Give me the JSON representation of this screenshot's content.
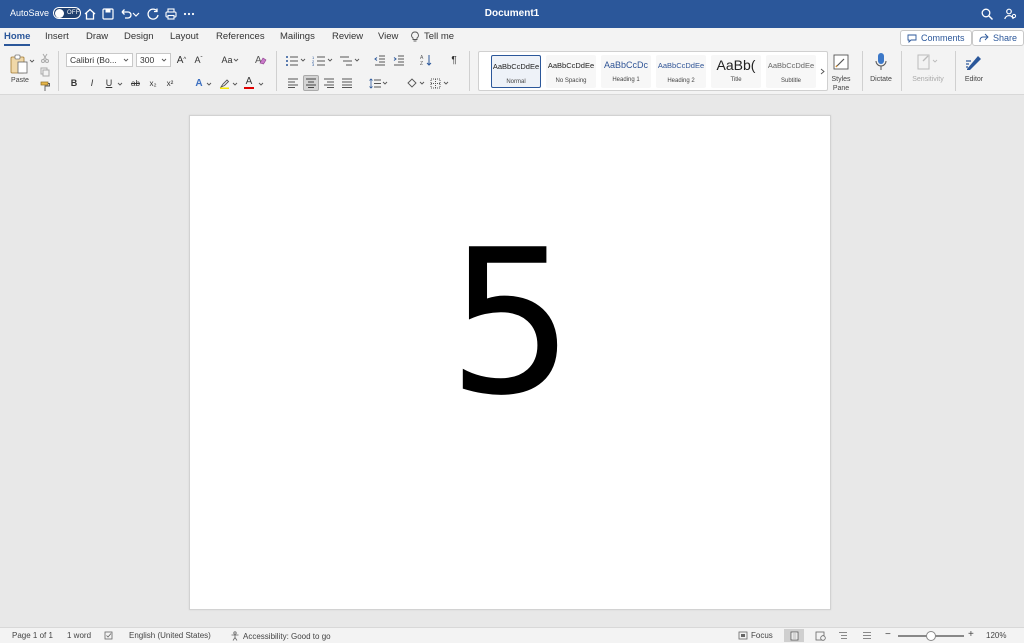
{
  "titlebar": {
    "autosave_label": "AutoSave",
    "autosave_state": "OFF",
    "doc_title": "Document1"
  },
  "tabs": [
    "Home",
    "Insert",
    "Draw",
    "Design",
    "Layout",
    "References",
    "Mailings",
    "Review",
    "View"
  ],
  "tell_me": "Tell me",
  "header_buttons": {
    "comments": "Comments",
    "share": "Share"
  },
  "ribbon": {
    "paste_label": "Paste",
    "font_name": "Calibri (Bo...",
    "font_size": "300",
    "case_label": "Aa",
    "bold": "B",
    "italic": "I",
    "underline": "U",
    "strike": "ab",
    "subscript": "x₂",
    "superscript": "x²",
    "font_color_glyph": "A",
    "text_effects_glyph": "A",
    "pilcrow": "¶",
    "styles": [
      {
        "sample": "AaBbCcDdEe",
        "name": "Normal"
      },
      {
        "sample": "AaBbCcDdEe",
        "name": "No Spacing"
      },
      {
        "sample": "AaBbCcDc",
        "name": "Heading 1"
      },
      {
        "sample": "AaBbCcDdEe",
        "name": "Heading 2"
      },
      {
        "sample": "AaBb(",
        "name": "Title"
      },
      {
        "sample": "AaBbCcDdEe",
        "name": "Subtitle"
      }
    ],
    "styles_pane": "Styles\nPane",
    "dictate": "Dictate",
    "sensitivity": "Sensitivity",
    "editor": "Editor"
  },
  "document": {
    "content": "5"
  },
  "status": {
    "page": "Page 1 of 1",
    "words": "1 word",
    "language": "English (United States)",
    "accessibility": "Accessibility: Good to go",
    "focus": "Focus",
    "zoom": "120%",
    "zoom_minus": "−",
    "zoom_plus": "+"
  },
  "colors": {
    "accent": "#2b579a",
    "font_color_underline": "#e00000"
  }
}
